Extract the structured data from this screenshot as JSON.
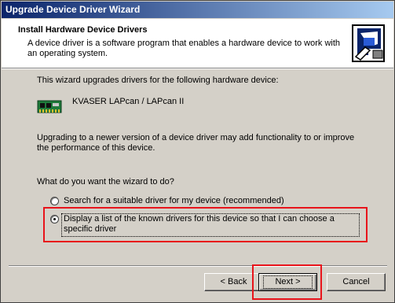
{
  "window": {
    "title": "Upgrade Device Driver Wizard"
  },
  "header": {
    "title": "Install Hardware Device Drivers",
    "subtitle": "A device driver is a software program that enables a hardware device to work with an operating system.",
    "icon": "hardware-wizard-icon"
  },
  "body": {
    "intro": "This wizard upgrades drivers for the following hardware device:",
    "device_name": "KVASER LAPcan / LAPcan II",
    "device_icon": "pcmcia-card-icon",
    "upgrade_note": "Upgrading to a newer version of a device driver may add functionality to or improve the performance of this device.",
    "question": "What do you want the wizard to do?",
    "options": [
      {
        "label": "Search for a suitable driver for my device (recommended)",
        "selected": false
      },
      {
        "label": "Display a list of the known drivers for this device so that I can choose a specific driver",
        "selected": true
      }
    ]
  },
  "buttons": {
    "back": "< Back",
    "next": "Next >",
    "cancel": "Cancel"
  },
  "colors": {
    "highlight": "#e8141b",
    "titlebar_start": "#0a246a",
    "titlebar_end": "#a6caf0"
  }
}
